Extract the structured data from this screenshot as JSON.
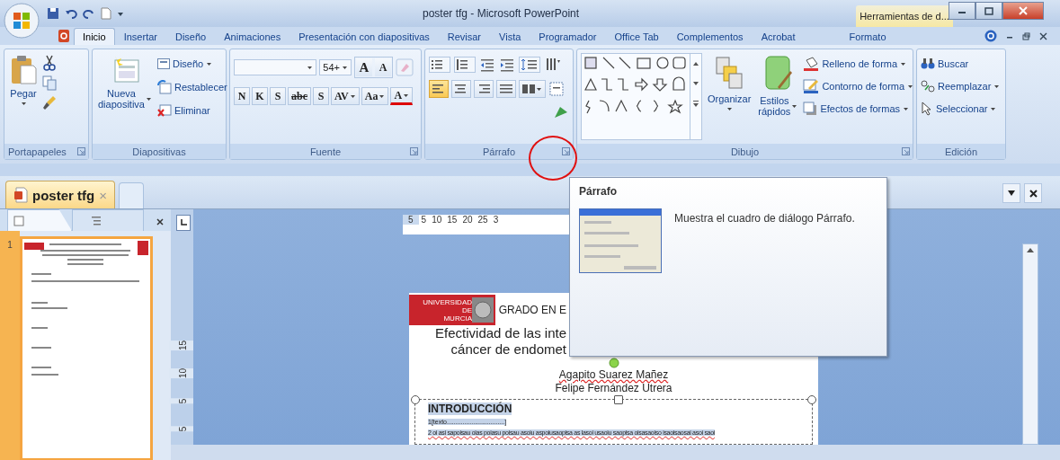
{
  "window": {
    "title": "poster tfg - Microsoft PowerPoint",
    "contextual_tab": "Herramientas de d..."
  },
  "tabs": [
    {
      "label": "Inicio",
      "selected": true
    },
    {
      "label": "Insertar",
      "selected": false
    },
    {
      "label": "Diseño",
      "selected": false
    },
    {
      "label": "Animaciones",
      "selected": false
    },
    {
      "label": "Presentación con diapositivas",
      "selected": false
    },
    {
      "label": "Revisar",
      "selected": false
    },
    {
      "label": "Vista",
      "selected": false
    },
    {
      "label": "Programador",
      "selected": false
    },
    {
      "label": "Office Tab",
      "selected": false
    },
    {
      "label": "Complementos",
      "selected": false
    },
    {
      "label": "Acrobat",
      "selected": false
    },
    {
      "label": "Formato",
      "selected": false
    }
  ],
  "ribbon": {
    "portapapeles": {
      "label": "Portapapeles",
      "paste": "Pegar"
    },
    "diapositivas": {
      "label": "Diapositivas",
      "new_slide": "Nueva diapositiva",
      "layout": "Diseño",
      "reset": "Restablecer",
      "delete": "Eliminar"
    },
    "fuente": {
      "label": "Fuente",
      "font_size": "54+",
      "size_buttons": [
        "A",
        "A"
      ],
      "format_buttons": [
        "N",
        "K",
        "S",
        "abc",
        "S",
        "AV",
        "Aa",
        "A"
      ]
    },
    "parrafo": {
      "label": "Párrafo",
      "alignments": [
        {
          "selected": true
        },
        {
          "selected": false
        },
        {
          "selected": false
        },
        {
          "selected": false
        }
      ]
    },
    "dibujo": {
      "label": "Dibujo",
      "arrange": "Organizar",
      "quick_styles": "Estilos rápidos",
      "fill": "Relleno de forma",
      "outline": "Contorno de forma",
      "effects": "Efectos de formas"
    },
    "edicion": {
      "label": "Edición",
      "find": "Buscar",
      "replace": "Reemplazar",
      "select": "Seleccionar"
    }
  },
  "doc_tabs": [
    {
      "label": "poster tfg",
      "close": "×"
    }
  ],
  "slide_panel": {
    "slide_number": "1"
  },
  "rulers": {
    "horizontal": [
      "5",
      "5",
      "10",
      "15",
      "20",
      "25",
      "3"
    ],
    "vertical": [
      "15",
      "10",
      "5",
      "5"
    ]
  },
  "tooltip": {
    "title": "Párrafo",
    "description": "Muestra el cuadro de diálogo Párrafo."
  },
  "slide": {
    "logo": [
      "UNIVERSIDAD DE",
      "MURCIA"
    ],
    "header": "GRADO EN E",
    "title_lines": [
      "Efectividad de las inte",
      "cáncer de endomet"
    ],
    "authors": [
      "Agapito Suarez Mañez",
      "Felipe Fernández Utrera"
    ],
    "section": "INTRODUCCIÓN",
    "lines": [
      "1[texto.................................]",
      "2 oi asi sapoisau oias poiasu poisau asoiu aspoiusaopisa as lasoi usaoiu saopisa oisasaoiso isaoisaosai asoi saoi"
    ]
  }
}
